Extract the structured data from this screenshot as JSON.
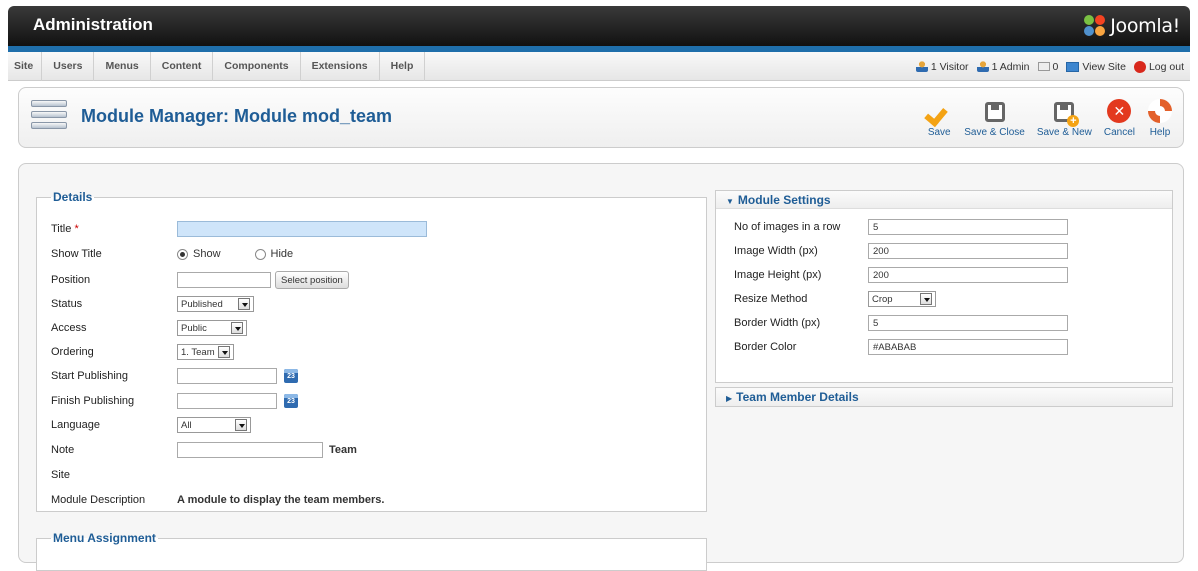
{
  "header": {
    "title": "Administration",
    "logo_text": "Joomla!"
  },
  "menu": {
    "items": [
      "Site",
      "Users",
      "Menus",
      "Content",
      "Components",
      "Extensions",
      "Help"
    ]
  },
  "status": {
    "visitors": "1 Visitor",
    "admins": "1 Admin",
    "messages": "0",
    "view_site": "View Site",
    "logout": "Log out"
  },
  "toolbar": {
    "page_title": "Module Manager: Module mod_team",
    "buttons": [
      "Save",
      "Save & Close",
      "Save & New",
      "Cancel",
      "Help"
    ]
  },
  "details": {
    "legend": "Details",
    "title_label": "Title",
    "required_mark": "*",
    "title_value": "",
    "show_title_label": "Show Title",
    "show_option": "Show",
    "hide_option": "Hide",
    "position_label": "Position",
    "position_value": "",
    "select_position_button": "Select position",
    "status_label": "Status",
    "status_value": "Published",
    "access_label": "Access",
    "access_value": "Public",
    "ordering_label": "Ordering",
    "ordering_value": "1. Team",
    "start_publishing_label": "Start Publishing",
    "finish_publishing_label": "Finish Publishing",
    "calendar_icon_text": "23",
    "language_label": "Language",
    "language_value": "All",
    "note_label": "Note",
    "note_value": "",
    "note_suffix": "Team",
    "site_label": "Site",
    "module_description_label": "Module Description",
    "module_description": "A module to display the team members."
  },
  "menu_assignment": {
    "legend": "Menu Assignment"
  },
  "module_settings": {
    "title": "Module Settings",
    "fields": {
      "images_per_row_label": "No of images in a row",
      "images_per_row": "5",
      "image_width_label": "Image Width (px)",
      "image_width": "200",
      "image_height_label": "Image Height (px)",
      "image_height": "200",
      "resize_method_label": "Resize Method",
      "resize_method": "Crop",
      "border_width_label": "Border Width (px)",
      "border_width": "5",
      "border_color_label": "Border Color",
      "border_color": "#ABABAB"
    }
  },
  "team_member_details": {
    "title": "Team Member Details"
  },
  "colors": {
    "accent_blue": "#1f5d96",
    "header_bar": "#1f6fab",
    "save_orange": "#f4a314",
    "cancel_red": "#e3391f"
  }
}
